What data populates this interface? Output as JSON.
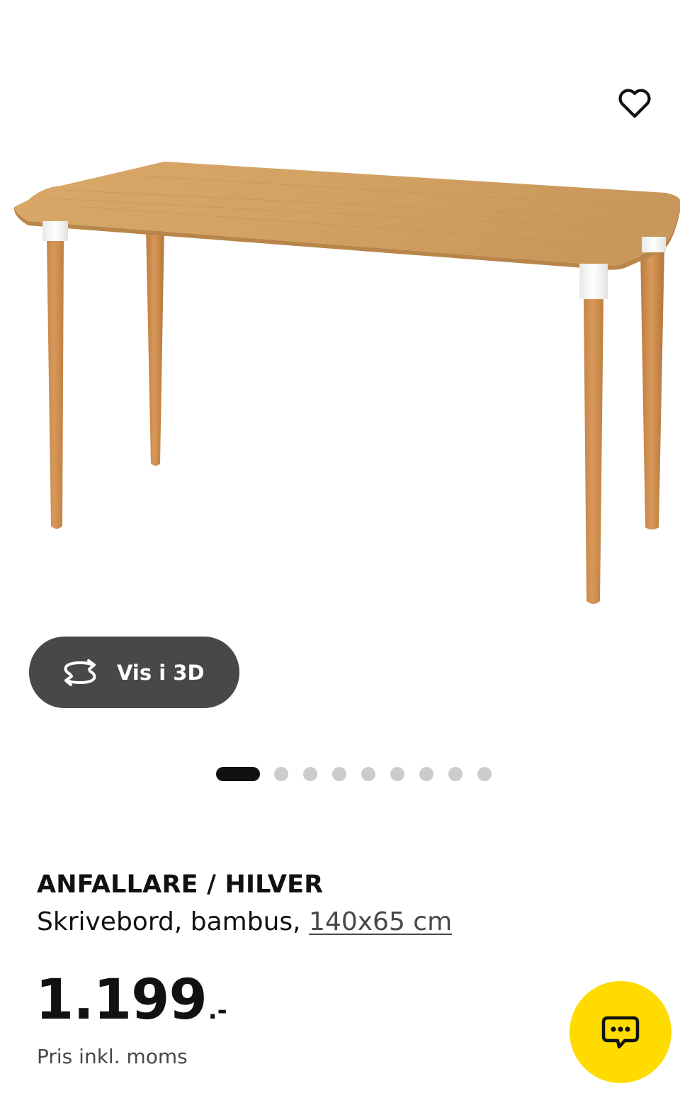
{
  "gallery": {
    "image_alt": "ANFALLARE / HILVER",
    "favourite_icon": "heart-outline-icon",
    "view_3d": {
      "label": "Vis i 3D",
      "icon": "rotate-3d-icon"
    },
    "pager": {
      "total": 9,
      "active_index": 0
    }
  },
  "product": {
    "name": "ANFALLARE / HILVER",
    "description": "Skrivebord, bambus, ",
    "size_link": "140x65 cm",
    "price": {
      "integer": "1.199",
      "suffix": ".-"
    },
    "price_note": "Pris inkl. moms"
  },
  "chat": {
    "icon": "chat-bubble-icon"
  },
  "colors": {
    "accent_yellow": "#FFDB00",
    "button_dark": "#484848",
    "text_primary": "#111111",
    "dot_inactive": "#CCCCCC",
    "bamboo": "#C99A5E"
  }
}
